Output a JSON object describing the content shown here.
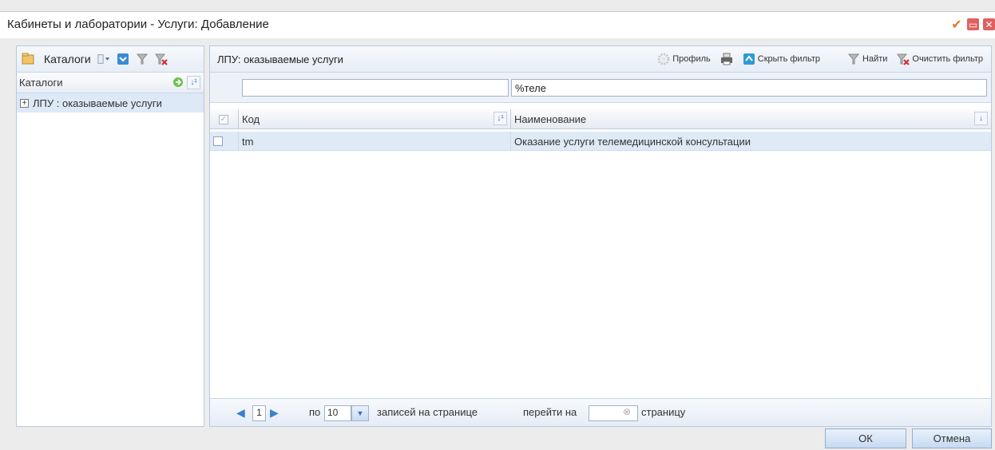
{
  "window": {
    "title": "Кабинеты и лаборатории - Услуги: Добавление"
  },
  "left_panel": {
    "toolbar_label": "Каталоги",
    "header": "Каталоги",
    "tree": [
      {
        "label": "ЛПУ : оказываемые услуги",
        "expander": "+"
      }
    ]
  },
  "right_panel": {
    "title": "ЛПУ: оказываемые услуги",
    "toolbar": {
      "profile": "Профиль",
      "hide_filter": "Скрыть фильтр",
      "find": "Найти",
      "clear_filter": "Очистить фильтр"
    },
    "filter": {
      "code_value": "",
      "name_value": "%теле"
    },
    "columns": [
      "Код",
      "Наименование"
    ],
    "rows": [
      {
        "code": "tm",
        "name": "Оказание услуги телемедицинской консультации"
      }
    ],
    "pager": {
      "current_page": "1",
      "per_label_before": "по",
      "per_page": "10",
      "per_label_after": "записей на странице",
      "goto_before": "перейти на",
      "goto_value": "",
      "goto_after": "страницу"
    }
  },
  "buttons": {
    "ok": "ОК",
    "cancel": "Отмена"
  },
  "icons": {
    "apply": "check-icon",
    "minimize": "minimize-icon",
    "close": "close-icon"
  },
  "colors": {
    "selection": "#dfeaf7",
    "accent": "#2b6cc4",
    "apply_check": "#e0782a"
  }
}
